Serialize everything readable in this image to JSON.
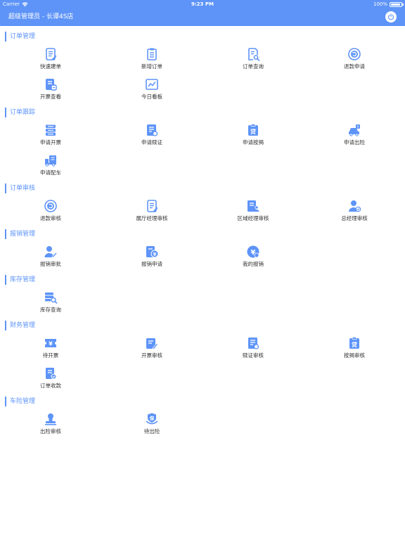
{
  "status_bar": {
    "carrier": "Carrier",
    "time": "9:23 PM",
    "battery": "100%"
  },
  "header": {
    "title": "超级管理员 - 长谭4S店"
  },
  "colors": {
    "primary": "#5e94f8",
    "text": "#333333",
    "background": "#ffffff"
  },
  "sections": [
    {
      "title": "订单管理",
      "items": [
        {
          "label": "快速建单",
          "icon": "document-edit-icon"
        },
        {
          "label": "新增订单",
          "icon": "clipboard-icon"
        },
        {
          "label": "订单查询",
          "icon": "document-search-icon"
        },
        {
          "label": "退款申请",
          "icon": "refund-icon"
        },
        {
          "label": "开票查看",
          "icon": "invoice-icon"
        },
        {
          "label": "今日看板",
          "icon": "chart-board-icon"
        }
      ]
    },
    {
      "title": "订单跟踪",
      "items": [
        {
          "label": "申请开票",
          "icon": "invoice-apply-icon"
        },
        {
          "label": "申请赎证",
          "icon": "certificate-icon"
        },
        {
          "label": "申请按揭",
          "icon": "loan-icon"
        },
        {
          "label": "申请出险",
          "icon": "car-accident-icon"
        },
        {
          "label": "申请配车",
          "icon": "truck-icon"
        }
      ]
    },
    {
      "title": "订单审核",
      "items": [
        {
          "label": "退款审核",
          "icon": "refund-audit-icon"
        },
        {
          "label": "展厅经理审核",
          "icon": "document-edit-icon"
        },
        {
          "label": "区域经理审核",
          "icon": "document-user-icon"
        },
        {
          "label": "总经理审核",
          "icon": "user-check-icon"
        }
      ]
    },
    {
      "title": "报销管理",
      "items": [
        {
          "label": "报销审批",
          "icon": "user-edit-icon"
        },
        {
          "label": "报销申请",
          "icon": "yuan-document-icon"
        },
        {
          "label": "我的报销",
          "icon": "yuan-circle-icon"
        }
      ]
    },
    {
      "title": "库存管理",
      "items": [
        {
          "label": "库存查询",
          "icon": "inventory-search-icon"
        }
      ]
    },
    {
      "title": "财务管理",
      "items": [
        {
          "label": "待开票",
          "icon": "ticket-icon"
        },
        {
          "label": "开票审核",
          "icon": "invoice-edit-icon"
        },
        {
          "label": "赎证审核",
          "icon": "certificate-icon"
        },
        {
          "label": "按揭审核",
          "icon": "loan-icon"
        },
        {
          "label": "订单收款",
          "icon": "document-check-icon"
        }
      ]
    },
    {
      "title": "车险管理",
      "items": [
        {
          "label": "出险审核",
          "icon": "stamp-icon"
        },
        {
          "label": "待出险",
          "icon": "insurance-icon"
        }
      ]
    }
  ]
}
